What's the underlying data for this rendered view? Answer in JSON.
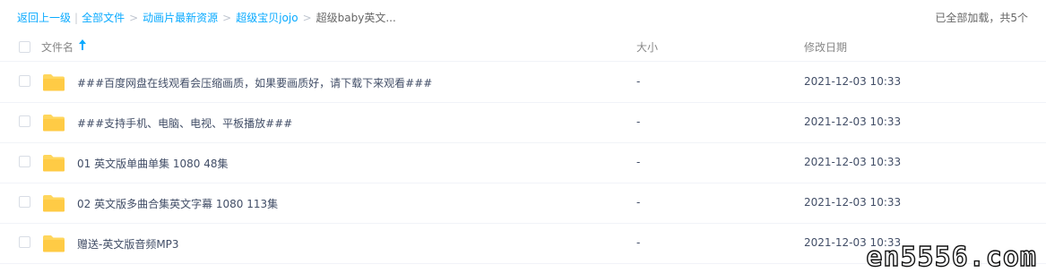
{
  "breadcrumb": {
    "back": "返回上一级",
    "all_files": "全部文件",
    "level1": "动画片最新资源",
    "level2": "超级宝贝jojo",
    "current": "超级baby英文...",
    "separator": ">"
  },
  "status": {
    "loaded_text": "已全部加载，共5个"
  },
  "columns": {
    "name": "文件名",
    "size": "大小",
    "date": "修改日期",
    "sort_icon": "arrow-up-icon"
  },
  "files": [
    {
      "name": "###百度网盘在线观看会压缩画质，如果要画质好，请下载下来观看###",
      "size": "-",
      "date": "2021-12-03 10:33"
    },
    {
      "name": "###支持手机、电脑、电视、平板播放###",
      "size": "-",
      "date": "2021-12-03 10:33"
    },
    {
      "name": "01 英文版单曲单集 1080 48集",
      "size": "-",
      "date": "2021-12-03 10:33"
    },
    {
      "name": "02 英文版多曲合集英文字幕 1080 113集",
      "size": "-",
      "date": "2021-12-03 10:33"
    },
    {
      "name": "赠送-英文版音频MP3",
      "size": "-",
      "date": "2021-12-03 10:33"
    }
  ],
  "watermark": "en5556.com",
  "colors": {
    "accent": "#09aaff",
    "folder": "#ffd65c",
    "text": "#424e67"
  }
}
